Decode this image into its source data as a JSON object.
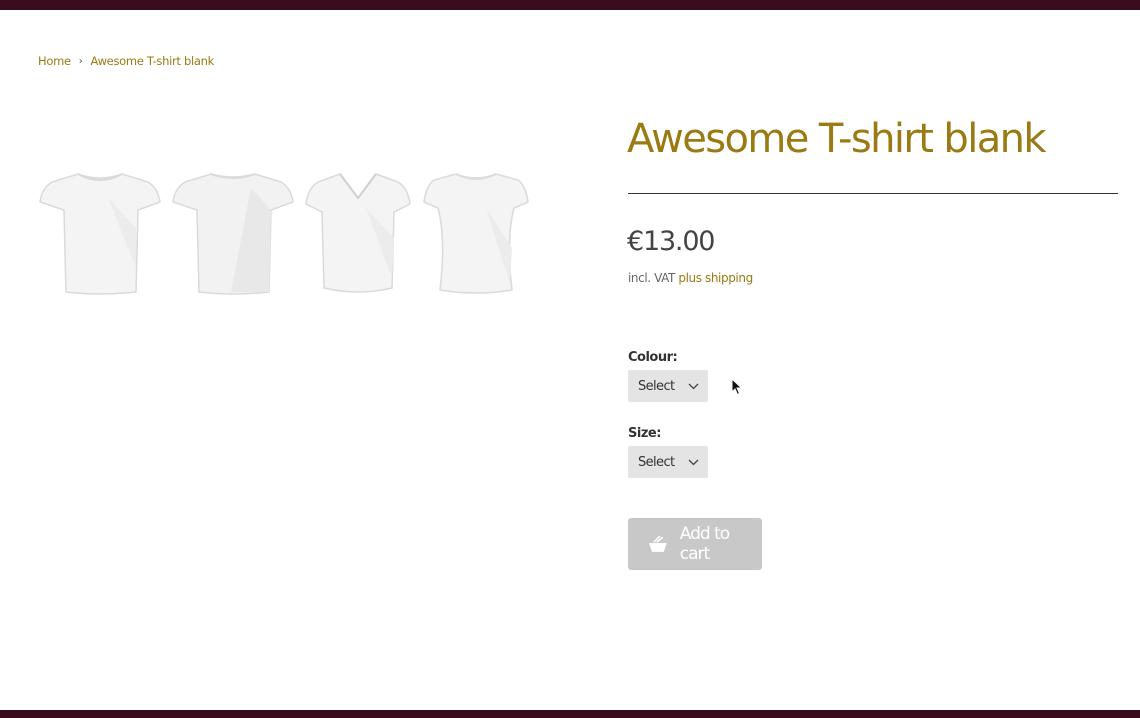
{
  "breadcrumb": {
    "home": "Home",
    "separator": "›",
    "current": "Awesome T-shirt blank"
  },
  "product": {
    "title": "Awesome T-shirt blank",
    "price": "€13.00",
    "vat_text": "incl. VAT",
    "shipping_link": "plus shipping",
    "images": [
      "crew-neck-tshirt-image",
      "crew-neck-tshirt-alt-image",
      "v-neck-tshirt-image",
      "womens-tshirt-image"
    ]
  },
  "options": {
    "colour_label": "Colour:",
    "colour_value": "Select",
    "size_label": "Size:",
    "size_value": "Select"
  },
  "cart": {
    "add_label": "Add to cart",
    "icon": "basket-icon"
  },
  "colors": {
    "accent": "#9a7a12",
    "bar": "#3a0c1e",
    "button_disabled": "#c8c8c8"
  }
}
